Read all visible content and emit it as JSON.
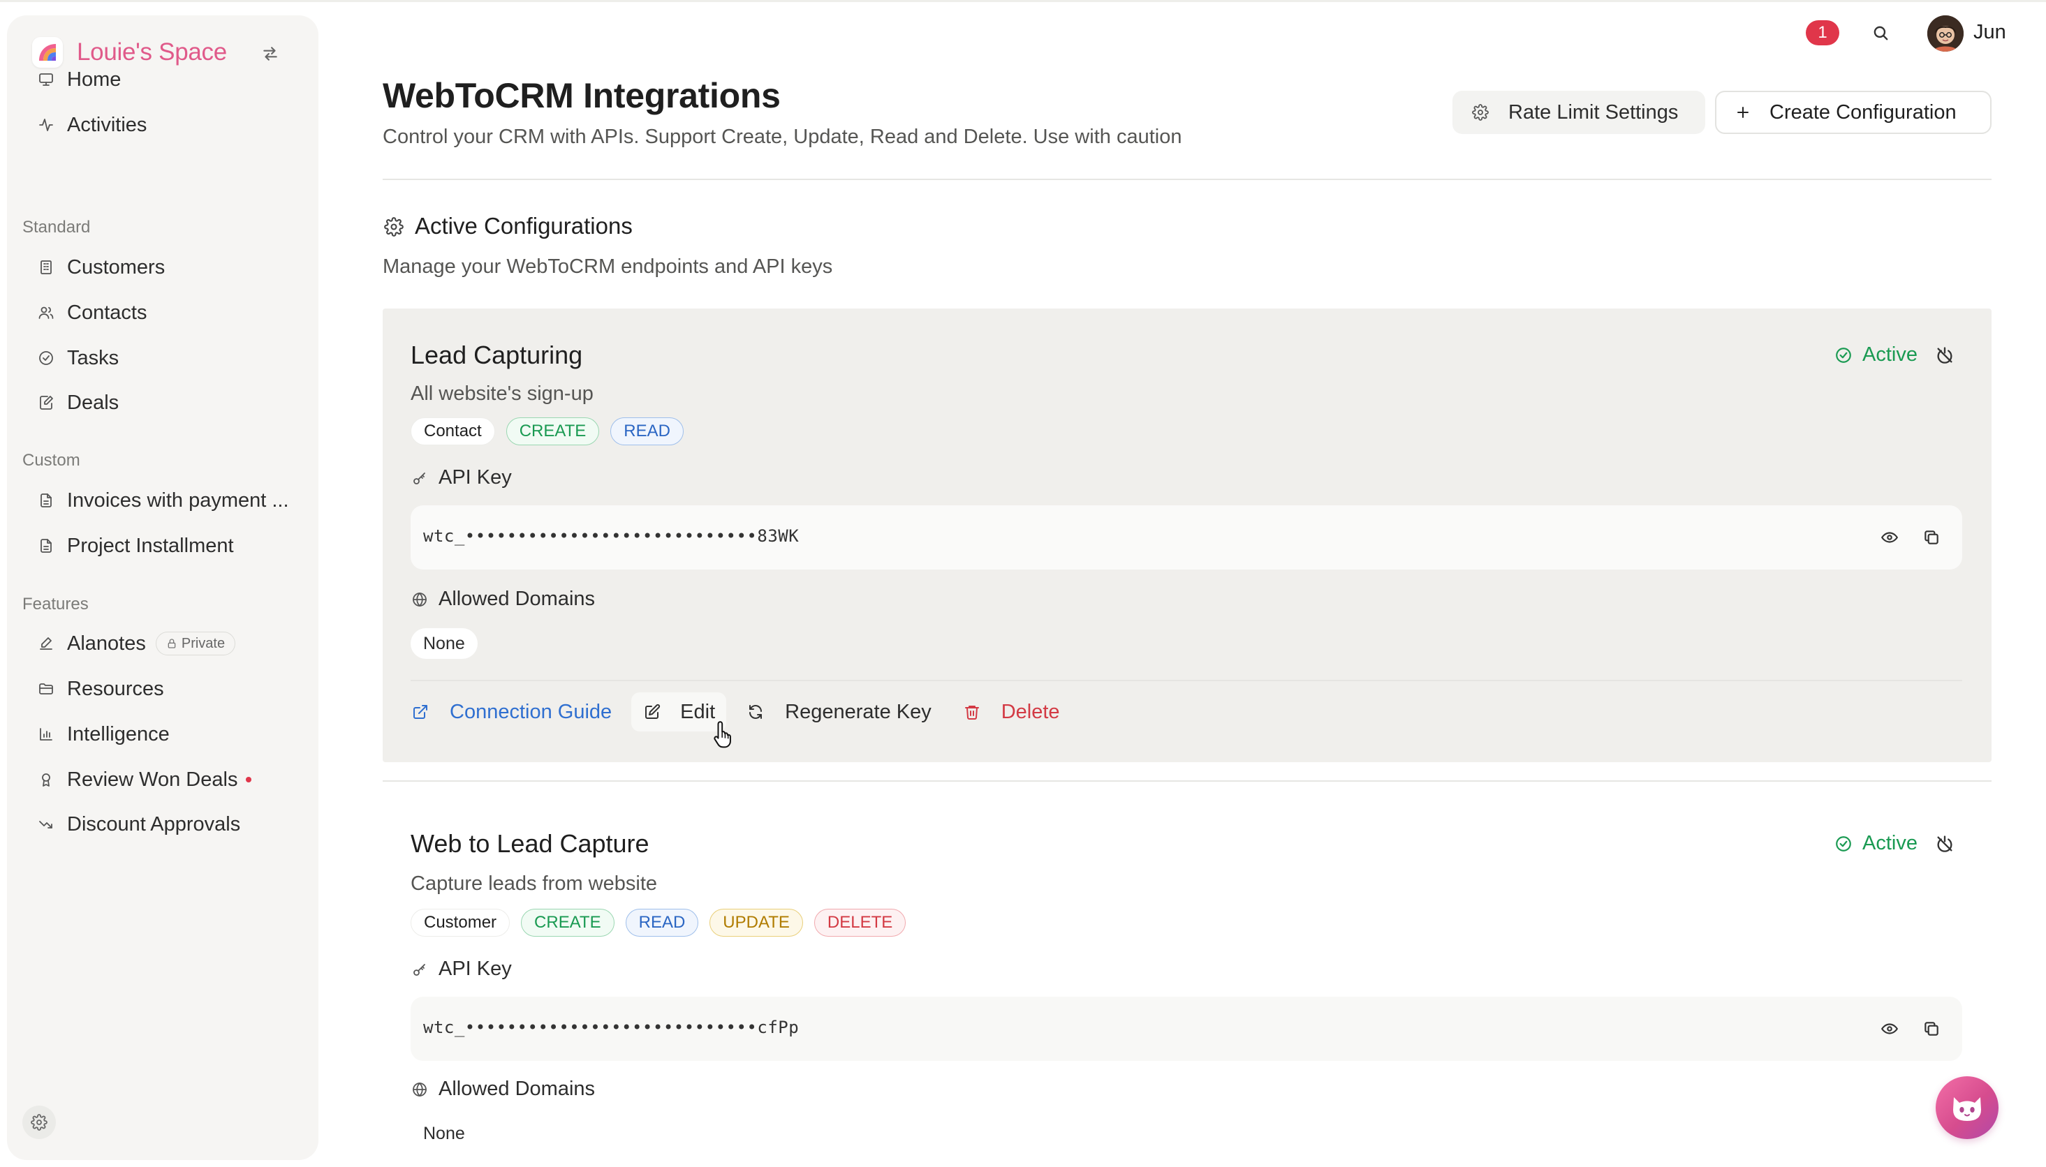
{
  "app": {
    "brand_name": "Louie's Space",
    "accent_color": "#e05a8a"
  },
  "sidebar": {
    "top_items": [
      {
        "label": "Home",
        "icon": "monitor-icon"
      },
      {
        "label": "Activities",
        "icon": "activity-icon"
      }
    ],
    "sections": [
      {
        "label": "Standard",
        "items": [
          {
            "label": "Customers",
            "icon": "building-icon"
          },
          {
            "label": "Contacts",
            "icon": "users-icon"
          },
          {
            "label": "Tasks",
            "icon": "check-circle-icon"
          },
          {
            "label": "Deals",
            "icon": "file-edit-icon"
          }
        ]
      },
      {
        "label": "Custom",
        "items": [
          {
            "label": "Invoices with payment ...",
            "icon": "document-icon"
          },
          {
            "label": "Project Installment",
            "icon": "document-icon"
          }
        ]
      },
      {
        "label": "Features",
        "items": [
          {
            "label": "Alanotes",
            "icon": "pen-icon",
            "badge": "Private"
          },
          {
            "label": "Resources",
            "icon": "folder-icon"
          },
          {
            "label": "Intelligence",
            "icon": "bar-chart-icon"
          },
          {
            "label": "Review Won Deals",
            "icon": "award-icon",
            "dot": true
          },
          {
            "label": "Discount Approvals",
            "icon": "trending-down-icon"
          }
        ]
      }
    ]
  },
  "topbar": {
    "notification_count": "1",
    "user_name": "Jun"
  },
  "header": {
    "title": "WebToCRM Integrations",
    "subtitle": "Control your CRM with APIs. Support Create, Update, Read and Delete. Use with caution",
    "rate_limit_button": "Rate Limit Settings",
    "create_button": "Create Configuration"
  },
  "section": {
    "title": "Active Configurations",
    "subtitle": "Manage your WebToCRM endpoints and API keys"
  },
  "labels": {
    "api_key": "API Key",
    "allowed_domains": "Allowed Domains",
    "connection_guide": "Connection Guide",
    "edit": "Edit",
    "regenerate_key": "Regenerate Key",
    "delete": "Delete"
  },
  "configurations": [
    {
      "title": "Lead Capturing",
      "description": "All website's sign-up",
      "entity": "Contact",
      "permissions": [
        "CREATE",
        "READ"
      ],
      "status": "Active",
      "api_key": "wtc_••••••••••••••••••••••••••••83WK",
      "allowed_domains": "None"
    },
    {
      "title": "Web to Lead Capture",
      "description": "Capture leads from website",
      "entity": "Customer",
      "permissions": [
        "CREATE",
        "READ",
        "UPDATE",
        "DELETE"
      ],
      "status": "Active",
      "api_key": "wtc_••••••••••••••••••••••••••••cfPp",
      "allowed_domains": "None"
    }
  ],
  "colors": {
    "active_green": "#1a9a52",
    "link_blue": "#2f6fd0",
    "danger_red": "#d33a44",
    "notification_red": "#e0364a"
  }
}
